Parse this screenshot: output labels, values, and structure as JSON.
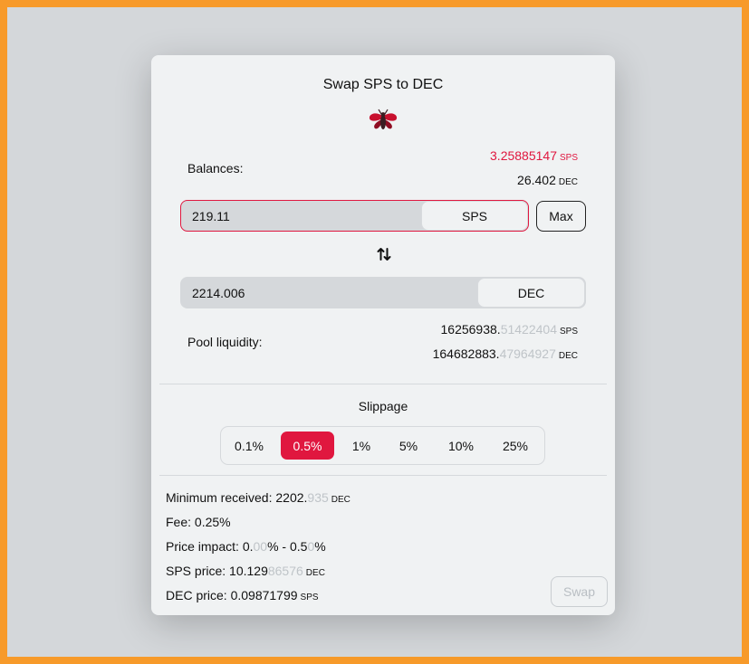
{
  "title": "Swap SPS to DEC",
  "logo_icon": "bee-logo-icon",
  "colors": {
    "accent": "#e0173f",
    "frame": "#f79a2a",
    "backdrop": "#d4d7da",
    "card": "#f0f2f3"
  },
  "balances": {
    "label": "Balances:",
    "sps": {
      "main": "3.25885147",
      "unit": "SPS"
    },
    "dec": {
      "main": "26.402",
      "unit": "DEC"
    }
  },
  "from": {
    "value": "219.11",
    "token": "SPS",
    "max_label": "Max"
  },
  "swap_icon": "swap-vertical-arrows-icon",
  "to": {
    "value": "2214.006",
    "token": "DEC"
  },
  "pool": {
    "label": "Pool liquidity:",
    "sps": {
      "main": "16256938.",
      "faded": "51422404",
      "unit": "SPS"
    },
    "dec": {
      "main": "164682883.",
      "faded": "47964927",
      "unit": "DEC"
    }
  },
  "slippage": {
    "label": "Slippage",
    "options": [
      "0.1%",
      "0.5%",
      "1%",
      "5%",
      "10%",
      "25%"
    ],
    "selected": "0.5%"
  },
  "details": {
    "min_received": {
      "label": "Minimum received: ",
      "main": "2202.",
      "faded": "935",
      "unit": "DEC"
    },
    "fee": {
      "label": "Fee: ",
      "value": "0.25%"
    },
    "price_impact": {
      "label": "Price impact: ",
      "a1": "0.",
      "a2": "00",
      "a3": "% - 0.5",
      "a4": "0",
      "a5": "%"
    },
    "sps_price": {
      "label": "SPS price: ",
      "main": "10.129",
      "faded": "86576",
      "unit": "DEC"
    },
    "dec_price": {
      "label": "DEC price: ",
      "main": "0.09871799",
      "unit": "SPS"
    }
  },
  "swap_label": "Swap"
}
